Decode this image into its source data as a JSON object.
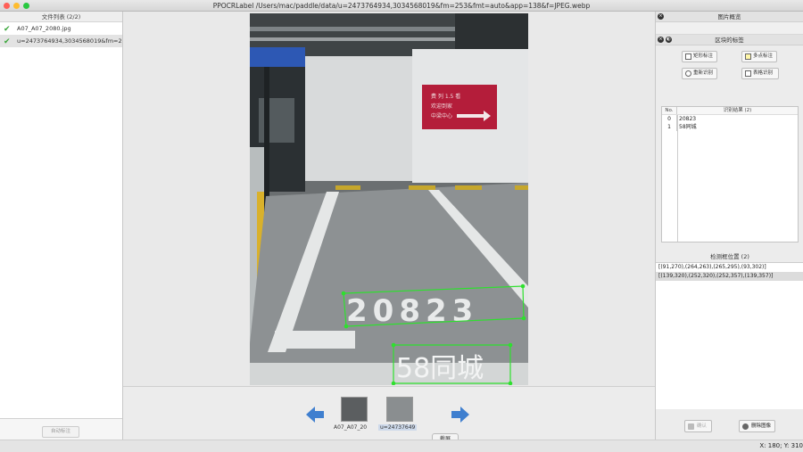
{
  "window": {
    "title": "PPOCRLabel /Users/mac/paddle/data/u=2473764934,3034568019&fm=253&fmt=auto&app=138&f=JPEG.webp"
  },
  "file_panel": {
    "header": "文件列表 (2/2)",
    "files": [
      {
        "name": "A07_A07_2080.jpg",
        "checked": true
      },
      {
        "name": "u=2473764934,3034568019&fm=253",
        "checked": true
      }
    ],
    "auto_button": "自动标注"
  },
  "canvas": {
    "photo_texts": {
      "box1": "20823",
      "box2": "58同城",
      "billboard_1": "费 列 1.5 看",
      "billboard_2": "欢迎到家",
      "billboard_3": "中梁中心"
    },
    "box_color": "#2ee02e"
  },
  "thumbnails": [
    {
      "label": "A07_A07_20"
    },
    {
      "label": "u=24737649"
    }
  ],
  "screenshot_button": "截屏",
  "right_panel": {
    "preview_header": "图片概览",
    "label_header": "区块的标签",
    "tools": {
      "rect": "矩形标注",
      "poly": "多点标注",
      "reocr": "重新识别",
      "table": "表格识别"
    },
    "results": {
      "col_no": "No.",
      "col_text": "识别结果 (2)",
      "rows": [
        {
          "no": "0",
          "text": "20823"
        },
        {
          "no": "1",
          "text": "58同城"
        }
      ]
    },
    "positions": {
      "header": "检测框位置 (2)",
      "items": [
        "[(91,270),(264,263),(265,295),(93,302)]",
        "[(139,320),(252,320),(252,357),(139,357)]"
      ]
    },
    "confirm_button": "确认",
    "delete_button": "删除图像"
  },
  "status": {
    "coords": "X: 180; Y: 310"
  }
}
